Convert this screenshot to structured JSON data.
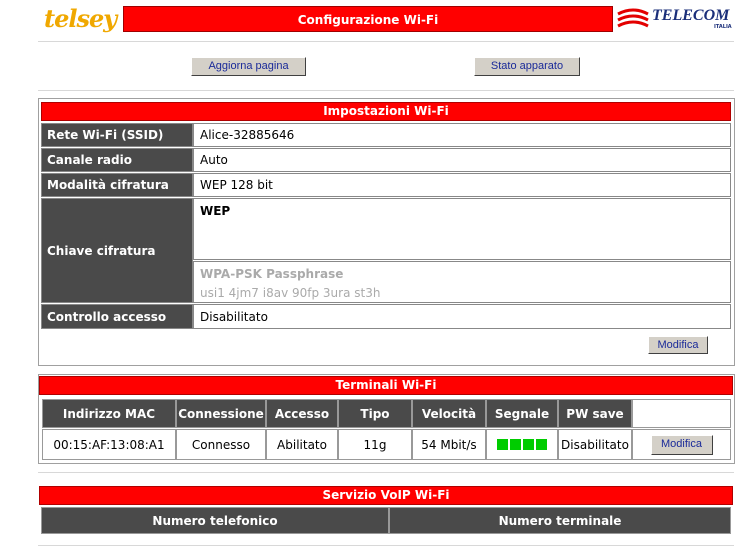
{
  "header": {
    "logo": "telsey",
    "title": "Configurazione Wi-Fi",
    "partner_logo": "TELECOM",
    "partner_sub": "ITALIA"
  },
  "toolbar": {
    "refresh_label": "Aggiorna pagina",
    "status_label": "Stato apparato"
  },
  "wifi_settings": {
    "title": "Impostazioni Wi-Fi",
    "rows": {
      "ssid": {
        "label": "Rete Wi-Fi (SSID)",
        "value": "Alice-32885646"
      },
      "channel": {
        "label": "Canale radio",
        "value": "Auto"
      },
      "encryption": {
        "label": "Modalità cifratura",
        "value": "WEP 128 bit"
      },
      "key": {
        "label": "Chiave cifratura",
        "wep_title": "WEP",
        "wpa_title": "WPA-PSK Passphrase",
        "wpa_value": "usi1 4jm7 i8av 90fp 3ura st3h"
      },
      "access": {
        "label": "Controllo accesso",
        "value": "Disabilitato"
      }
    },
    "edit_label": "Modifica"
  },
  "terminals": {
    "title": "Terminali Wi-Fi",
    "columns": [
      "Indirizzo MAC",
      "Connessione",
      "Accesso",
      "Tipo",
      "Velocità",
      "Segnale",
      "PW save"
    ],
    "rows": [
      {
        "mac": "00:15:AF:13:08:A1",
        "connection": "Connesso",
        "access": "Abilitato",
        "type": "11g",
        "speed": "54 Mbit/s",
        "signal_bars": 4,
        "pw_save": "Disabilitato",
        "edit_label": "Modifica"
      }
    ]
  },
  "voip": {
    "title": "Servizio VoIP Wi-Fi",
    "columns": [
      "Numero telefonico",
      "Numero terminale"
    ]
  },
  "colors": {
    "accent": "#ff0000",
    "label_bg": "#4a4a4a",
    "signal": "#00cc00"
  }
}
